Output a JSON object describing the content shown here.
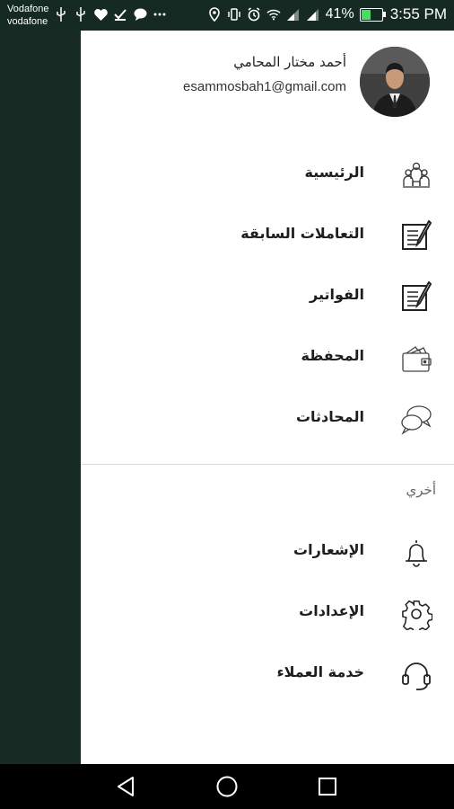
{
  "status_bar": {
    "carrier_1": "Vodafone",
    "carrier_2": "vodafone",
    "battery_percent": "41%",
    "time": "3:55 PM",
    "icons_left": [
      "usb-icon",
      "usb-icon",
      "heart-icon",
      "download-done-icon",
      "chat-bubble-icon",
      "more-icon"
    ],
    "icons_right": [
      "location-icon",
      "vibrate-icon",
      "alarm-icon",
      "wifi-icon",
      "signal-icon",
      "signal-icon",
      "battery-charging-icon"
    ]
  },
  "profile": {
    "name": "أحمد مختار المحامي",
    "email": "esammosbah1@gmail.com"
  },
  "menu": {
    "items": [
      {
        "label": "الرئيسية",
        "icon": "home-people-icon"
      },
      {
        "label": "التعاملات السابقة",
        "icon": "document-edit-icon"
      },
      {
        "label": "الفواتير",
        "icon": "invoice-edit-icon"
      },
      {
        "label": "المحفظة",
        "icon": "wallet-icon"
      },
      {
        "label": "المحادثات",
        "icon": "chat-icon"
      }
    ]
  },
  "other_section": {
    "title": "أخري",
    "items": [
      {
        "label": "الإشعارات",
        "icon": "bell-icon"
      },
      {
        "label": "الإعدادات",
        "icon": "gear-icon"
      },
      {
        "label": "خدمة العملاء",
        "icon": "headset-icon"
      }
    ]
  },
  "colors": {
    "background_dark": "#152a22",
    "drawer": "#ffffff",
    "text": "#1e1e1e"
  }
}
